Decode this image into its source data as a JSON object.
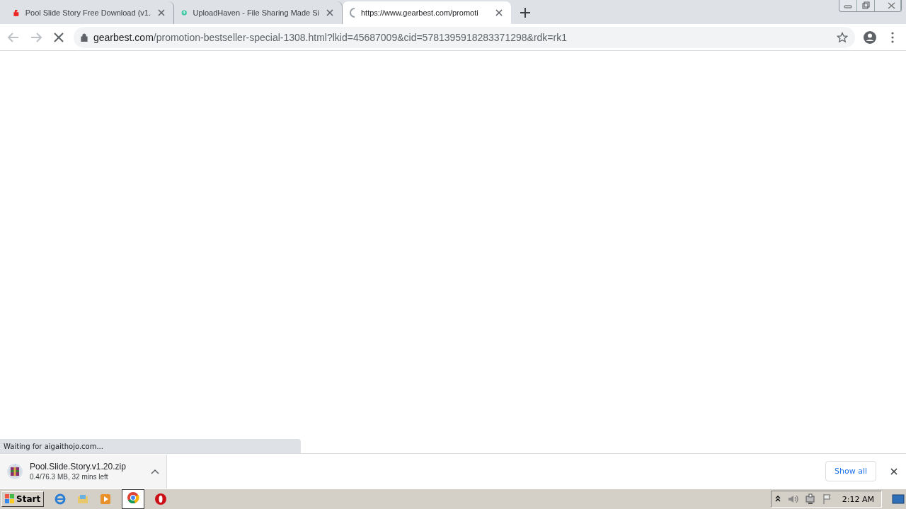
{
  "tabs": [
    {
      "title": "Pool Slide Story Free Download (v1.",
      "kind": "lock",
      "selected": false
    },
    {
      "title": "UploadHaven - File Sharing Made Si",
      "kind": "cloud",
      "selected": false
    },
    {
      "title": "https://www.gearbest.com/promoti",
      "kind": "spinner",
      "selected": true
    }
  ],
  "address_bar": {
    "host": "gearbest.com",
    "path": "/promotion-bestseller-special-1308.html?lkid=45687009&cid=5781395918283371298&rdk=rk1"
  },
  "status_bubble": "Waiting for aigaithojo.com...",
  "download_shelf": {
    "file_name": "Pool.Slide.Story.v1.20.zip",
    "progress": "0.4/76.3 MB, 32 mins left",
    "level": 0.005,
    "show_all": "Show all"
  },
  "taskbar": {
    "start": "Start",
    "clock": "2:12 AM"
  }
}
